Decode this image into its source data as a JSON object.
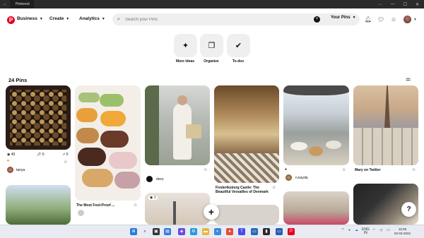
{
  "window": {
    "tab_title": "Pinterest",
    "back": "←",
    "min": "—",
    "max": "☐",
    "close": "✕",
    "menu": "⋯"
  },
  "nav": {
    "logo": "P",
    "business": "Business",
    "create": "Create",
    "analytics": "Analytics",
    "search_placeholder": "Search your Pins",
    "your_pins": "Your Pins",
    "chevron": "⌄"
  },
  "tools": [
    {
      "label": "More ideas",
      "icon": "✦"
    },
    {
      "label": "Organize",
      "icon": "❐"
    },
    {
      "label": "To-dos",
      "icon": "✔"
    }
  ],
  "pin_count": "24 Pins",
  "pins": {
    "chocolates": {
      "stat1": "49",
      "stat2": "0",
      "stat3": "0",
      "user": "tanya"
    },
    "macarons": {
      "title": "The Most Fool-Proof ..."
    },
    "lady": {
      "user": "docs"
    },
    "palace": {
      "title": "Frederiksborg Castle: The Beautiful Versailles of Denmark"
    },
    "cafe": {
      "user": "n.kayda"
    },
    "paris": {
      "title": "Mary on Twitter"
    },
    "eiffel2": {
      "stat": "1"
    }
  },
  "buttons": {
    "add": "+",
    "help": "?"
  },
  "taskbar": {
    "lang1": "ENG",
    "lang2": "IN",
    "time": "10:05",
    "date": "02-03-2022",
    "tray_arrow": "^"
  }
}
